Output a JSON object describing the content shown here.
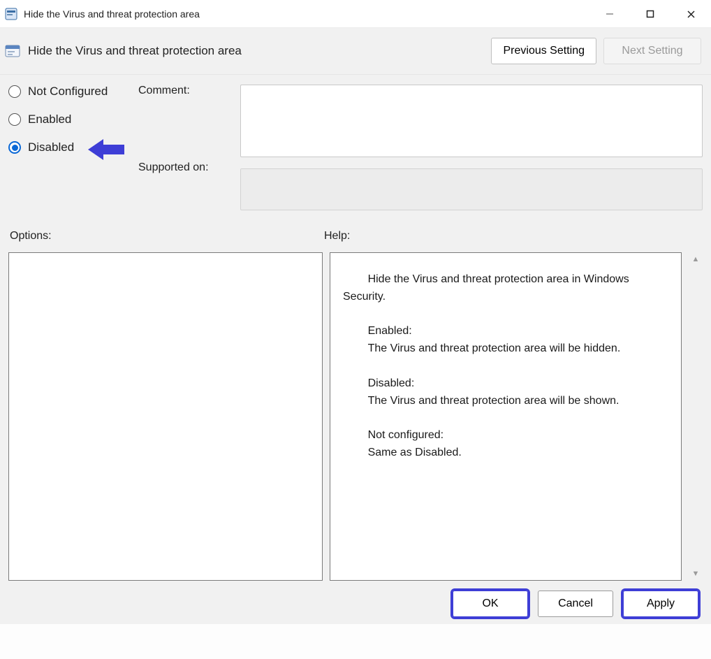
{
  "window": {
    "title": "Hide the Virus and threat protection area",
    "minimize_label": "Minimize",
    "maximize_label": "Maximize",
    "close_label": "Close"
  },
  "header": {
    "policy_name": "Hide the Virus and threat protection area",
    "previous_setting": "Previous Setting",
    "next_setting": "Next Setting",
    "next_disabled": true
  },
  "options": {
    "state_options": {
      "not_configured": "Not Configured",
      "enabled": "Enabled",
      "disabled": "Disabled"
    },
    "selected_state": "disabled",
    "comment_label": "Comment:",
    "comment_value": "",
    "supported_label": "Supported on:",
    "supported_value": ""
  },
  "sections": {
    "options_label": "Options:",
    "help_label": "Help:",
    "options_content": "",
    "help_content": "        Hide the Virus and threat protection area in Windows Security.\n\n        Enabled:\n        The Virus and threat protection area will be hidden.\n\n        Disabled:\n        The Virus and threat protection area will be shown.\n\n        Not configured:\n        Same as Disabled."
  },
  "footer": {
    "ok": "OK",
    "cancel": "Cancel",
    "apply": "Apply"
  }
}
